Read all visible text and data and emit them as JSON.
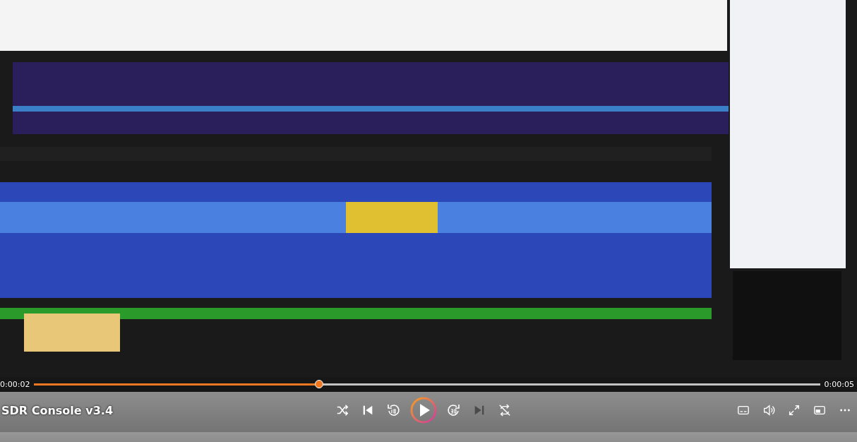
{
  "video": {
    "title": "SDR Console v3.4",
    "elapsed": "0:00:02",
    "duration": "0:00:05",
    "progress": {
      "level": 0.363
    },
    "playing": false
  },
  "transport": [
    {
      "kind": "shuffle",
      "disabled": false
    },
    {
      "kind": "previous",
      "disabled": false
    },
    {
      "kind": "rewind",
      "disabled": false
    },
    {
      "kind": "play",
      "disabled": false
    },
    {
      "kind": "forward",
      "disabled": false
    },
    {
      "kind": "next",
      "disabled": true
    },
    {
      "kind": "repeat",
      "disabled": false
    }
  ],
  "tools": [
    {
      "kind": "captions"
    },
    {
      "kind": "volume"
    },
    {
      "kind": "fullscreen"
    },
    {
      "kind": "miniplayer"
    },
    {
      "kind": "more"
    }
  ]
}
